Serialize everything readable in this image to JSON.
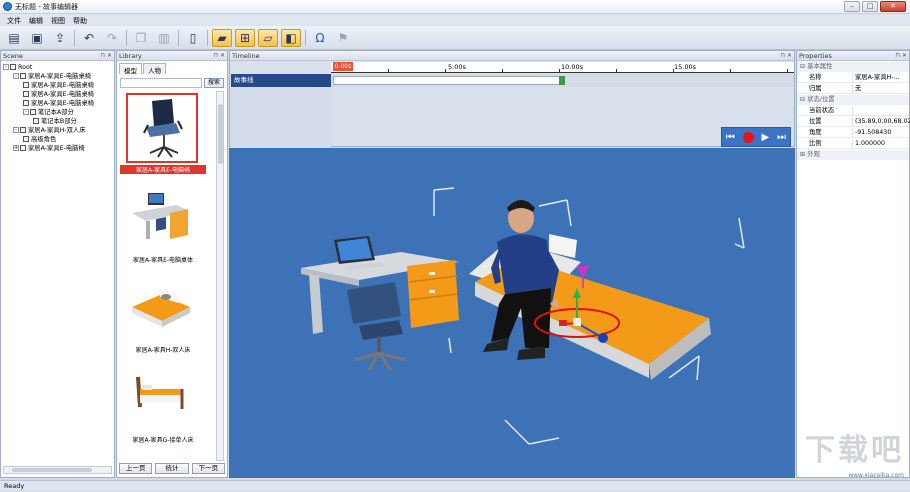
{
  "window": {
    "title": "无标题 - 故事编辑器"
  },
  "menu": [
    "文件",
    "编辑",
    "视图",
    "帮助"
  ],
  "scene": {
    "title": "Scene",
    "tree": [
      {
        "label": "Root",
        "level": 0,
        "expander": "-"
      },
      {
        "label": "家居A-家具E-电脑桌椅",
        "level": 1,
        "expander": "-"
      },
      {
        "label": "家居A-家具E-电脑桌椅",
        "level": 2,
        "expander": ""
      },
      {
        "label": "家居A-家具E-电脑桌椅",
        "level": 2,
        "expander": ""
      },
      {
        "label": "家居A-家具E-电脑桌椅",
        "level": 2,
        "expander": ""
      },
      {
        "label": "笔记本A部分",
        "level": 2,
        "expander": "-"
      },
      {
        "label": "笔记本B部分",
        "level": 3,
        "expander": ""
      },
      {
        "label": "家居A-家具H-双人床",
        "level": 1,
        "expander": "-"
      },
      {
        "label": "高级角色",
        "level": 2,
        "expander": ""
      },
      {
        "label": "家居A-家具E-电脑椅",
        "level": 1,
        "expander": "+"
      }
    ]
  },
  "library": {
    "title": "Library",
    "tabs": [
      "模型",
      "人物"
    ],
    "search_label": "搜索",
    "items": [
      {
        "caption": "家居A-家具E-电脑椅",
        "icon": "office-chair"
      },
      {
        "caption": "家居A-家具E-电脑桌体",
        "icon": "computer-desk"
      },
      {
        "caption": "家居A-家具H-双人床",
        "icon": "double-bed"
      },
      {
        "caption": "家居A-家具G-接单人床",
        "icon": "single-bed"
      }
    ],
    "buttons": {
      "prev": "上一页",
      "count": "统计",
      "next": "下一页"
    }
  },
  "timeline": {
    "title": "Timeline",
    "track_name": "故事线",
    "playhead": "0.00s",
    "ticks": [
      "5.00s",
      "10.00s",
      "15.00s"
    ],
    "controls": [
      "skip-back-icon",
      "record-icon",
      "play-icon",
      "skip-forward-icon"
    ]
  },
  "properties": {
    "title": "Properties",
    "sections": {
      "basic": "基本属性",
      "status": "状态/位置",
      "other": "外观"
    },
    "rows": {
      "name": {
        "key": "名称",
        "value": "家居A-家具H-..."
      },
      "parent": {
        "key": "归属",
        "value": "无"
      },
      "state": {
        "key": "当前状态",
        "value": ""
      },
      "position": {
        "key": "位置",
        "value": "(35.89,0.00,68.02)"
      },
      "angle": {
        "key": "角度",
        "value": "-91.508430"
      },
      "scale": {
        "key": "比例",
        "value": "1.000000"
      }
    }
  },
  "status": {
    "text": "Ready"
  },
  "watermark": {
    "text": "下载吧",
    "sub": "www.xiazaiba.com"
  }
}
